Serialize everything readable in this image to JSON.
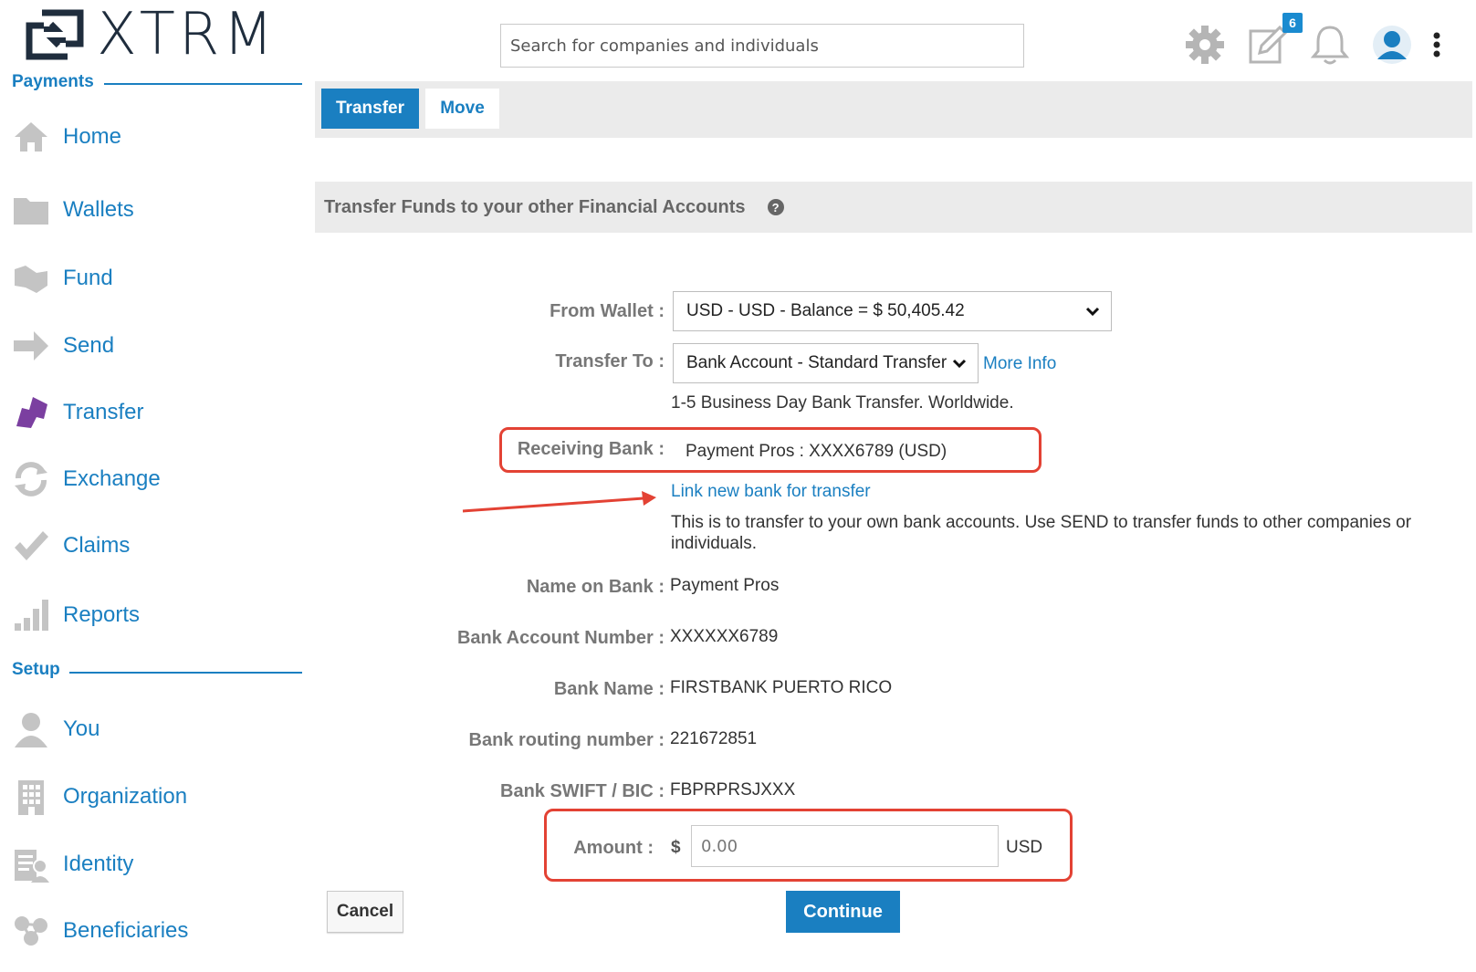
{
  "header": {
    "logo_text": "XTRM",
    "search_placeholder": "Search for companies and individuals",
    "notification_count": "6",
    "icons": [
      "gear-icon",
      "edit-icon",
      "bell-icon",
      "user-avatar-icon",
      "more-vertical-icon"
    ]
  },
  "sidebar": {
    "payments_title": "Payments",
    "payments_items": [
      {
        "label": "Home",
        "icon": "home-icon"
      },
      {
        "label": "Wallets",
        "icon": "folder-icon"
      },
      {
        "label": "Fund",
        "icon": "fund-icon"
      },
      {
        "label": "Send",
        "icon": "arrow-right-icon"
      },
      {
        "label": "Transfer",
        "icon": "transfer-icon"
      },
      {
        "label": "Exchange",
        "icon": "exchange-icon"
      },
      {
        "label": "Claims",
        "icon": "check-icon"
      },
      {
        "label": "Reports",
        "icon": "bar-chart-icon"
      }
    ],
    "setup_title": "Setup",
    "setup_items": [
      {
        "label": "You",
        "icon": "user-icon"
      },
      {
        "label": "Organization",
        "icon": "building-icon"
      },
      {
        "label": "Identity",
        "icon": "identity-icon"
      },
      {
        "label": "Beneficiaries",
        "icon": "beneficiaries-icon"
      }
    ]
  },
  "tabs": [
    {
      "label": "Transfer",
      "active": true
    },
    {
      "label": "Move",
      "active": false
    }
  ],
  "form": {
    "title": "Transfer Funds to your other Financial Accounts",
    "help_glyph": "?",
    "from_wallet_label": "From Wallet :",
    "from_wallet_value": "USD - USD - Balance = $ 50,405.42",
    "transfer_to_label": "Transfer To :",
    "transfer_to_value": "Bank Account - Standard Transfer",
    "more_info_link": "More Info",
    "transfer_to_note": "1-5 Business Day Bank Transfer. Worldwide.",
    "receiving_bank_label": "Receiving Bank :",
    "receiving_bank_value": "Payment Pros : XXXX6789 (USD)",
    "link_new_bank": "Link new bank for transfer",
    "own_accounts_note": "This is to transfer to your own bank accounts. Use SEND to transfer funds to other companies or individuals.",
    "name_on_bank_label": "Name on Bank :",
    "name_on_bank_value": "Payment Pros",
    "account_number_label": "Bank Account Number :",
    "account_number_value": "XXXXXX6789",
    "bank_name_label": "Bank Name :",
    "bank_name_value": "FIRSTBANK PUERTO RICO",
    "routing_label": "Bank routing number :",
    "routing_value": "221672851",
    "swift_label": "Bank SWIFT / BIC :",
    "swift_value": "FBPRPRSJXXX",
    "amount_label": "Amount :",
    "amount_currency_symbol": "$",
    "amount_placeholder": "0.00",
    "amount_currency": "USD",
    "cancel_label": "Cancel",
    "continue_label": "Continue"
  },
  "colors": {
    "accent": "#1a7fc1",
    "highlight_red": "#e34234",
    "transfer_icon_purple": "#7b3fa0"
  }
}
